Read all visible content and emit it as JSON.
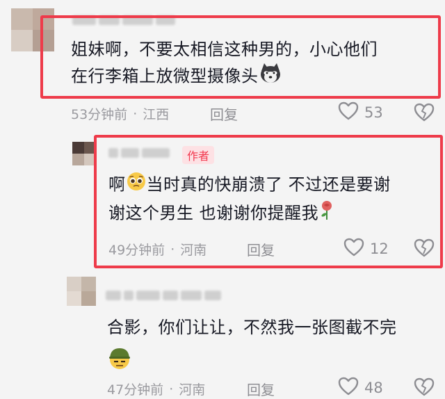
{
  "comments": [
    {
      "text_line1": "姐妹啊，不要太相信这种男的，小心他们",
      "text_line2": "在行李箱上放微型摄像头",
      "time": "53分钟前",
      "location": "江西",
      "reply_label": "回复",
      "likes": "53"
    },
    {
      "author_tag": "作者",
      "text_line1_a": "啊",
      "text_line1_b": "当时真的快崩溃了 不过还是要谢",
      "text_line2": "谢这个男生 也谢谢你提醒我",
      "time": "49分钟前",
      "location": "河南",
      "reply_label": "回复",
      "likes": "12"
    },
    {
      "text_line1": "合影，你们让让，不然我一张图截不完",
      "time": "47分钟前",
      "location": "河南",
      "reply_label": "回复",
      "likes": "48"
    }
  ],
  "meta_separator": "·",
  "colors": {
    "highlight_border": "#ee3b4a",
    "author_tag_bg": "#fde1e4",
    "author_tag_text": "#f2394f"
  },
  "icons": [
    "heart-outline-icon",
    "broken-heart-icon",
    "husky-emoji-icon",
    "pleading-face-emoji-icon",
    "rose-emoji-icon",
    "soldier-face-emoji-icon"
  ]
}
